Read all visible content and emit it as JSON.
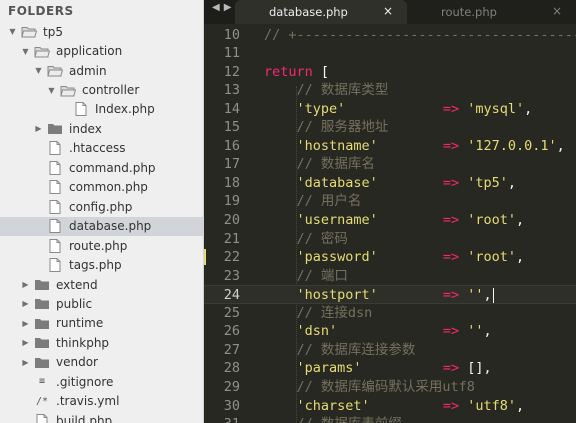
{
  "sidebar": {
    "header": "FOLDERS",
    "items": [
      {
        "label": "tp5",
        "type": "folder",
        "depth": 0,
        "expanded": true,
        "icon": "folder-open-icon"
      },
      {
        "label": "application",
        "type": "folder",
        "depth": 1,
        "expanded": true,
        "icon": "folder-open-icon"
      },
      {
        "label": "admin",
        "type": "folder",
        "depth": 2,
        "expanded": true,
        "icon": "folder-open-icon"
      },
      {
        "label": "controller",
        "type": "folder",
        "depth": 3,
        "expanded": true,
        "icon": "folder-open-icon"
      },
      {
        "label": "Index.php",
        "type": "file",
        "depth": 4,
        "icon": "file-icon"
      },
      {
        "label": "index",
        "type": "folder",
        "depth": 2,
        "expanded": false,
        "icon": "folder-icon"
      },
      {
        "label": ".htaccess",
        "type": "file",
        "depth": 2,
        "icon": "file-icon"
      },
      {
        "label": "command.php",
        "type": "file",
        "depth": 2,
        "icon": "file-icon"
      },
      {
        "label": "common.php",
        "type": "file",
        "depth": 2,
        "icon": "file-icon"
      },
      {
        "label": "config.php",
        "type": "file",
        "depth": 2,
        "icon": "file-icon"
      },
      {
        "label": "database.php",
        "type": "file",
        "depth": 2,
        "icon": "file-icon",
        "selected": true
      },
      {
        "label": "route.php",
        "type": "file",
        "depth": 2,
        "icon": "file-icon"
      },
      {
        "label": "tags.php",
        "type": "file",
        "depth": 2,
        "icon": "file-icon"
      },
      {
        "label": "extend",
        "type": "folder",
        "depth": 1,
        "expanded": false,
        "icon": "folder-icon"
      },
      {
        "label": "public",
        "type": "folder",
        "depth": 1,
        "expanded": false,
        "icon": "folder-icon"
      },
      {
        "label": "runtime",
        "type": "folder",
        "depth": 1,
        "expanded": false,
        "icon": "folder-icon"
      },
      {
        "label": "thinkphp",
        "type": "folder",
        "depth": 1,
        "expanded": false,
        "icon": "folder-icon"
      },
      {
        "label": "vendor",
        "type": "folder",
        "depth": 1,
        "expanded": false,
        "icon": "folder-icon"
      },
      {
        "label": ".gitignore",
        "type": "file",
        "depth": 1,
        "icon": "lines-file-icon",
        "glyph": "≡"
      },
      {
        "label": ".travis.yml",
        "type": "file",
        "depth": 1,
        "icon": "comment-file-icon",
        "glyph": "/*"
      },
      {
        "label": "build.php",
        "type": "file",
        "depth": 1,
        "icon": "file-icon"
      }
    ]
  },
  "tabs": [
    {
      "title": "database.php",
      "active": true,
      "close": "×"
    },
    {
      "title": "route.php",
      "active": false,
      "close": "×"
    }
  ],
  "nav": {
    "back": "◀",
    "forward": "▶"
  },
  "editor": {
    "current_line": 24,
    "lines": [
      {
        "n": "10",
        "tokens": [
          {
            "t": "// +--------------------------------------------",
            "c": "comment"
          }
        ]
      },
      {
        "n": "11",
        "tokens": []
      },
      {
        "n": "12",
        "tokens": [
          {
            "t": "return",
            "c": "kw"
          },
          {
            "t": " [",
            "c": "punc"
          }
        ]
      },
      {
        "n": "13",
        "tokens": [
          {
            "t": "    // 数据库类型",
            "c": "comment"
          }
        ]
      },
      {
        "n": "14",
        "tokens": [
          {
            "t": "    ",
            "c": "punc"
          },
          {
            "t": "'type'",
            "c": "str"
          },
          {
            "t": "            ",
            "c": "punc"
          },
          {
            "t": "=>",
            "c": "op"
          },
          {
            "t": " ",
            "c": "punc"
          },
          {
            "t": "'mysql'",
            "c": "str"
          },
          {
            "t": ",",
            "c": "punc"
          }
        ]
      },
      {
        "n": "15",
        "tokens": [
          {
            "t": "    // 服务器地址",
            "c": "comment"
          }
        ]
      },
      {
        "n": "16",
        "tokens": [
          {
            "t": "    ",
            "c": "punc"
          },
          {
            "t": "'hostname'",
            "c": "str"
          },
          {
            "t": "        ",
            "c": "punc"
          },
          {
            "t": "=>",
            "c": "op"
          },
          {
            "t": " ",
            "c": "punc"
          },
          {
            "t": "'127.0.0.1'",
            "c": "str"
          },
          {
            "t": ",",
            "c": "punc"
          }
        ]
      },
      {
        "n": "17",
        "tokens": [
          {
            "t": "    // 数据库名",
            "c": "comment"
          }
        ]
      },
      {
        "n": "18",
        "tokens": [
          {
            "t": "    ",
            "c": "punc"
          },
          {
            "t": "'database'",
            "c": "str"
          },
          {
            "t": "        ",
            "c": "punc"
          },
          {
            "t": "=>",
            "c": "op"
          },
          {
            "t": " ",
            "c": "punc"
          },
          {
            "t": "'tp5'",
            "c": "str"
          },
          {
            "t": ",",
            "c": "punc"
          }
        ]
      },
      {
        "n": "19",
        "tokens": [
          {
            "t": "    // 用户名",
            "c": "comment"
          }
        ]
      },
      {
        "n": "20",
        "tokens": [
          {
            "t": "    ",
            "c": "punc"
          },
          {
            "t": "'username'",
            "c": "str"
          },
          {
            "t": "        ",
            "c": "punc"
          },
          {
            "t": "=>",
            "c": "op"
          },
          {
            "t": " ",
            "c": "punc"
          },
          {
            "t": "'root'",
            "c": "str"
          },
          {
            "t": ",",
            "c": "punc"
          }
        ]
      },
      {
        "n": "21",
        "tokens": [
          {
            "t": "    // 密码",
            "c": "comment"
          }
        ]
      },
      {
        "n": "22",
        "tokens": [
          {
            "t": "    ",
            "c": "punc"
          },
          {
            "t": "'password'",
            "c": "str"
          },
          {
            "t": "        ",
            "c": "punc"
          },
          {
            "t": "=>",
            "c": "op"
          },
          {
            "t": " ",
            "c": "punc"
          },
          {
            "t": "'root'",
            "c": "str"
          },
          {
            "t": ",",
            "c": "punc"
          }
        ],
        "marked": true
      },
      {
        "n": "23",
        "tokens": [
          {
            "t": "    // 端口",
            "c": "comment"
          }
        ]
      },
      {
        "n": "24",
        "tokens": [
          {
            "t": "    ",
            "c": "punc"
          },
          {
            "t": "'hostport'",
            "c": "str"
          },
          {
            "t": "        ",
            "c": "punc"
          },
          {
            "t": "=>",
            "c": "op"
          },
          {
            "t": " ",
            "c": "punc"
          },
          {
            "t": "''",
            "c": "str"
          },
          {
            "t": ",",
            "c": "punc"
          }
        ],
        "cursor": true
      },
      {
        "n": "25",
        "tokens": [
          {
            "t": "    // 连接dsn",
            "c": "comment"
          }
        ]
      },
      {
        "n": "26",
        "tokens": [
          {
            "t": "    ",
            "c": "punc"
          },
          {
            "t": "'dsn'",
            "c": "str"
          },
          {
            "t": "             ",
            "c": "punc"
          },
          {
            "t": "=>",
            "c": "op"
          },
          {
            "t": " ",
            "c": "punc"
          },
          {
            "t": "''",
            "c": "str"
          },
          {
            "t": ",",
            "c": "punc"
          }
        ]
      },
      {
        "n": "27",
        "tokens": [
          {
            "t": "    // 数据库连接参数",
            "c": "comment"
          }
        ]
      },
      {
        "n": "28",
        "tokens": [
          {
            "t": "    ",
            "c": "punc"
          },
          {
            "t": "'params'",
            "c": "str"
          },
          {
            "t": "          ",
            "c": "punc"
          },
          {
            "t": "=>",
            "c": "op"
          },
          {
            "t": " [],",
            "c": "punc"
          }
        ]
      },
      {
        "n": "29",
        "tokens": [
          {
            "t": "    // 数据库编码默认采用utf8",
            "c": "comment"
          }
        ]
      },
      {
        "n": "30",
        "tokens": [
          {
            "t": "    ",
            "c": "punc"
          },
          {
            "t": "'charset'",
            "c": "str"
          },
          {
            "t": "         ",
            "c": "punc"
          },
          {
            "t": "=>",
            "c": "op"
          },
          {
            "t": " ",
            "c": "punc"
          },
          {
            "t": "'utf8'",
            "c": "str"
          },
          {
            "t": ",",
            "c": "punc"
          }
        ]
      },
      {
        "n": "31",
        "tokens": [
          {
            "t": "    // 数据库表前缀",
            "c": "comment"
          }
        ]
      }
    ]
  },
  "colors": {
    "editor_bg": "#272822",
    "keyword": "#f92672",
    "string": "#e6db74",
    "comment": "#75715e",
    "sidebar_bg": "#efefef",
    "selected_row": "#d1d5da"
  }
}
